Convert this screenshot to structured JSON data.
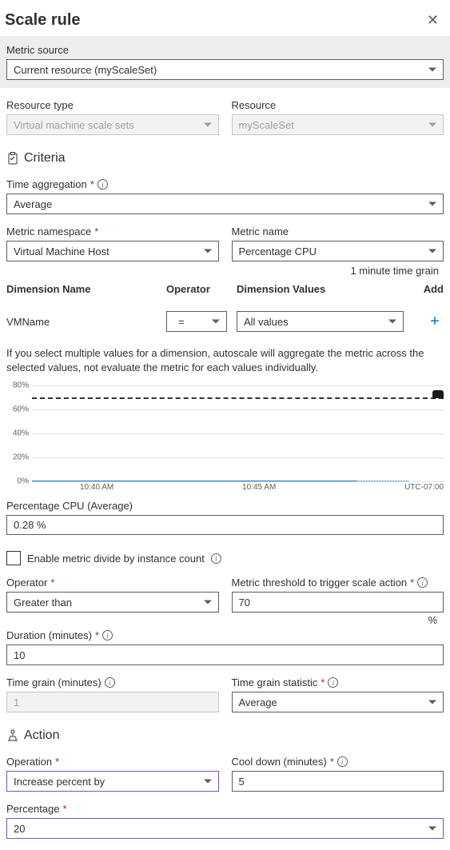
{
  "header": {
    "title": "Scale rule"
  },
  "metric_source": {
    "label": "Metric source",
    "value": "Current resource (myScaleSet)"
  },
  "resource_type": {
    "label": "Resource type",
    "value": "Virtual machine scale sets"
  },
  "resource": {
    "label": "Resource",
    "value": "myScaleSet"
  },
  "criteria": {
    "heading": "Criteria"
  },
  "time_aggregation": {
    "label": "Time aggregation",
    "value": "Average"
  },
  "metric_namespace": {
    "label": "Metric namespace",
    "value": "Virtual Machine Host"
  },
  "metric_name": {
    "label": "Metric name",
    "value": "Percentage CPU"
  },
  "time_grain_note": "1 minute time grain",
  "dimensions": {
    "headers": {
      "name": "Dimension Name",
      "operator": "Operator",
      "values": "Dimension Values",
      "add": "Add"
    },
    "rows": [
      {
        "name": "VMName",
        "operator": "=",
        "values": "All values"
      }
    ]
  },
  "helper_text": "If you select multiple values for a dimension, autoscale will aggregate the metric across the selected values, not evaluate the metric for each values individually.",
  "chart_data": {
    "type": "line",
    "title": "",
    "xlabel": "",
    "ylabel": "",
    "ylim": [
      0,
      80
    ],
    "y_ticks": [
      "0%",
      "20%",
      "40%",
      "60%",
      "80%"
    ],
    "x_ticks": [
      "10:40 AM",
      "10:45 AM"
    ],
    "timezone": "UTC-07:00",
    "threshold": 70,
    "series": [
      {
        "name": "Percentage CPU",
        "approx_value": 0.28
      }
    ]
  },
  "metric_display": {
    "label": "Percentage CPU (Average)",
    "value": "0.28 %"
  },
  "divide_checkbox": {
    "label": "Enable metric divide by instance count",
    "checked": false
  },
  "operator": {
    "label": "Operator",
    "value": "Greater than"
  },
  "threshold": {
    "label": "Metric threshold to trigger scale action",
    "value": "70",
    "unit": "%"
  },
  "duration": {
    "label": "Duration (minutes)",
    "value": "10"
  },
  "time_grain": {
    "label": "Time grain (minutes)",
    "value": "1"
  },
  "time_grain_stat": {
    "label": "Time grain statistic",
    "value": "Average"
  },
  "action": {
    "heading": "Action"
  },
  "operation": {
    "label": "Operation",
    "value": "Increase percent by"
  },
  "cooldown": {
    "label": "Cool down (minutes)",
    "value": "5"
  },
  "percentage": {
    "label": "Percentage",
    "value": "20"
  }
}
